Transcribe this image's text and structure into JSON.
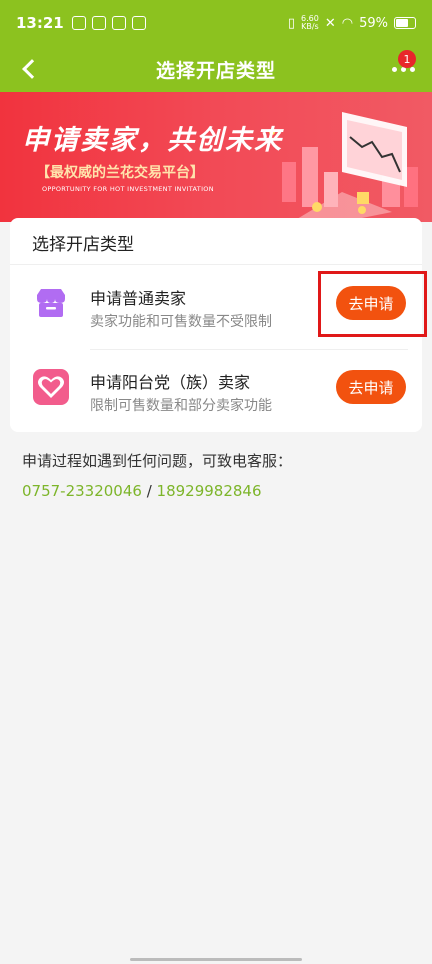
{
  "status_bar": {
    "time": "13:21",
    "net_speed_value": "6.60",
    "net_speed_unit": "KB/s",
    "battery": "59%"
  },
  "header": {
    "title": "选择开店类型",
    "badge_count": "1"
  },
  "banner": {
    "headline": "申请卖家，共创未来",
    "subheadline": "【最权威的兰花交易平台】",
    "english_tagline": "OPPORTUNITY FOR HOT INVESTMENT INVITATION"
  },
  "card": {
    "title": "选择开店类型",
    "options": [
      {
        "title": "申请普通卖家",
        "description": "卖家功能和可售数量不受限制",
        "button_label": "去申请",
        "icon": "shop-icon"
      },
      {
        "title": "申请阳台党（族）卖家",
        "description": "限制可售数量和部分卖家功能",
        "button_label": "去申请",
        "icon": "heart-icon"
      }
    ]
  },
  "contact": {
    "message": "申请过程如遇到任何问题，可致电客服：",
    "phone1": "0757-23320046",
    "separator": " / ",
    "phone2": "18929982846"
  },
  "colors": {
    "brand_green": "#8cc21f",
    "button_orange": "#f2520f",
    "link_green": "#7db52a",
    "highlight_red": "#e01818"
  }
}
